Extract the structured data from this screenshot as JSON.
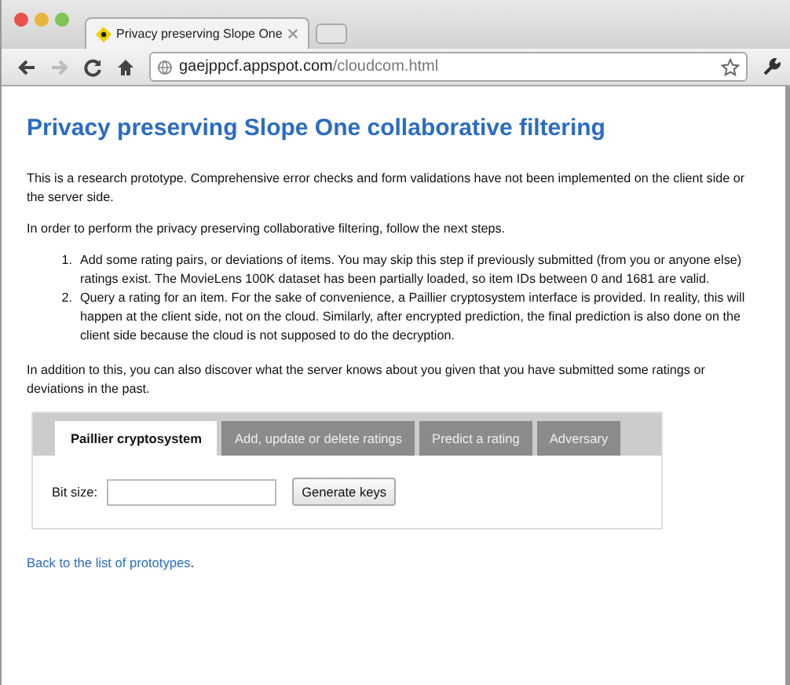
{
  "browser": {
    "tabs": [
      {
        "title": "Privacy preserving Slope One",
        "selected": true
      }
    ],
    "address": {
      "host": "gaejppcf.appspot.com",
      "path": "/cloudcom.html"
    }
  },
  "page": {
    "title": "Privacy preserving Slope One collaborative filtering",
    "intro": "This is a research prototype. Comprehensive error checks and form validations have not been implemented on the client side or the server side.",
    "lead": "In order to perform the privacy preserving collaborative filtering, follow the next steps.",
    "steps": [
      {
        "number": "1.",
        "text": "Add some rating pairs, or deviations of items. You may skip this step if previously submitted (from you or anyone else) ratings exist. The MovieLens 100K dataset has been partially loaded, so item IDs between 0 and 1681 are valid."
      },
      {
        "number": "2.",
        "text": "Query a rating for an item. For the sake of convenience, a Paillier cryptosystem interface is provided. In reality, this will happen at the client side, not on the cloud. Similarly, after encrypted prediction, the final prediction is also done on the client side because the cloud is not supposed to do the decryption."
      }
    ],
    "addition": "In addition to this, you can also discover what the server knows about you given that you have submitted some ratings or deviations in the past.",
    "panel": {
      "tabs": [
        {
          "label": "Paillier cryptosystem",
          "selected": true
        },
        {
          "label": "Add, update or delete ratings",
          "selected": false
        },
        {
          "label": "Predict a rating",
          "selected": false
        },
        {
          "label": "Adversary",
          "selected": false
        }
      ],
      "field_label": "Bit size:",
      "button": "Generate keys"
    },
    "back_link": "Back to the list of prototypes",
    "back_suffix": "."
  }
}
